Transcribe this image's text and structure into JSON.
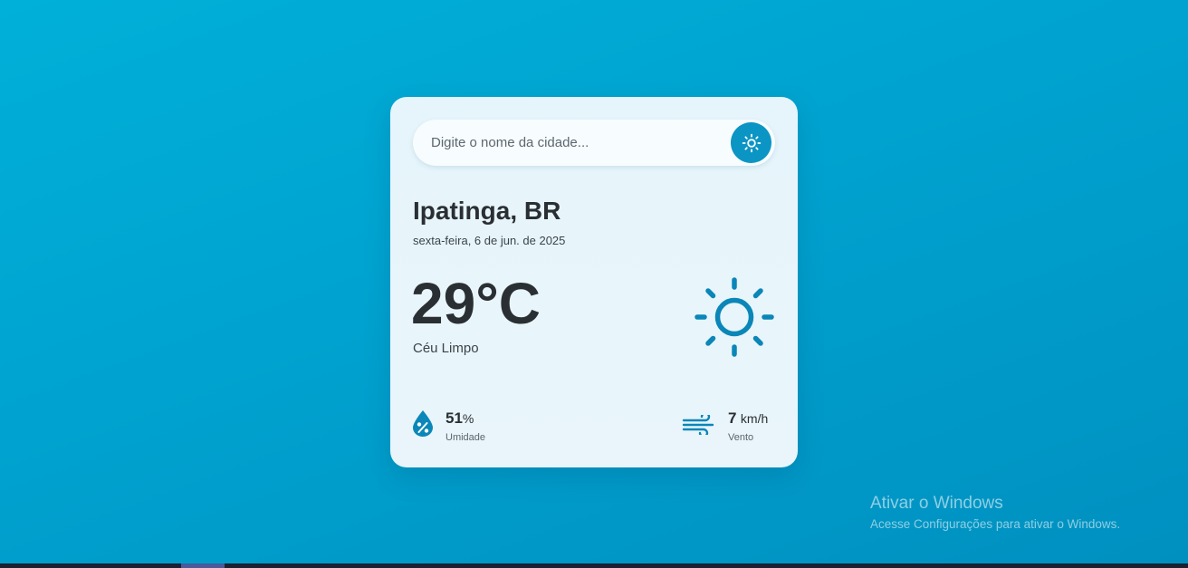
{
  "search": {
    "placeholder": "Digite o nome da cidade...",
    "value": "",
    "button_icon": "sun-icon"
  },
  "weather": {
    "city": "Ipatinga, BR",
    "date": "sexta-feira, 6 de jun. de 2025",
    "temperature": "29°C",
    "condition": "Céu Limpo",
    "condition_icon": "sun-icon"
  },
  "stats": {
    "humidity": {
      "value": "51",
      "unit": "%",
      "label": "Umidade",
      "icon": "humidity-drop-icon"
    },
    "wind": {
      "value": "7",
      "unit": "km/h",
      "label": "Vento",
      "icon": "wind-icon"
    }
  },
  "watermark": {
    "title": "Ativar o Windows",
    "subtitle": "Acesse Configurações para ativar o Windows."
  },
  "colors": {
    "background_start": "#00b0d8",
    "background_end": "#0090c0",
    "accent": "#0b95c4",
    "icon": "#0b86b8",
    "text_primary": "#2a2f33"
  }
}
